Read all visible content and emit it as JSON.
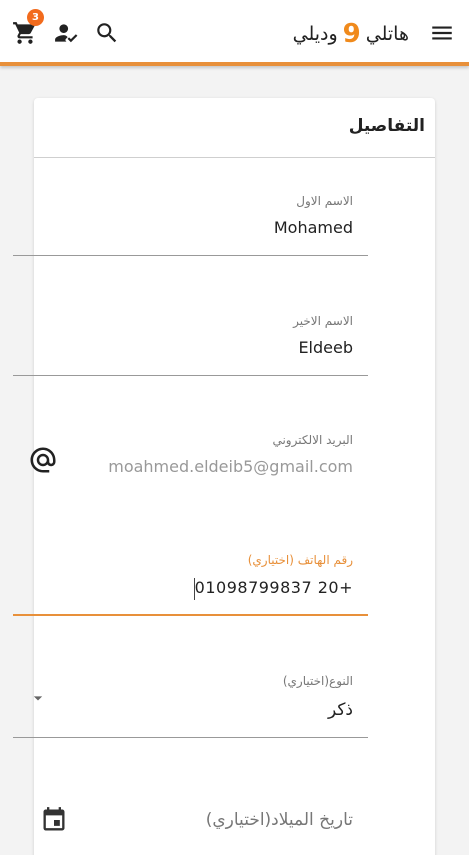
{
  "header": {
    "cart_count": "3",
    "logo_left": "هاتلي",
    "logo_number": "9",
    "logo_right": "وديلي",
    "accent_color": "#e8903a",
    "icons": [
      "cart-icon",
      "user-check-icon",
      "search-icon",
      "menu-icon"
    ]
  },
  "card": {
    "title": "التفاصيل"
  },
  "form": {
    "first_name": {
      "label": "الاسم الاول",
      "value": "Mohamed"
    },
    "last_name": {
      "label": "الاسم الاخير",
      "value": "Eldeeb"
    },
    "email": {
      "label": "البريد الالكتروني",
      "value": "moahmed.eldeib5@gmail.com",
      "icon": "at-icon"
    },
    "phone": {
      "label": "رقم الهاتف (اختياري)",
      "value": "01098799837  20+"
    },
    "gender": {
      "label": "النوع(اختياري)",
      "value": "ذكر",
      "icon": "dropdown-arrow-icon"
    },
    "birth_date": {
      "placeholder": "تاريخ الميلاد(اختياري)",
      "icon": "calendar-icon"
    }
  }
}
